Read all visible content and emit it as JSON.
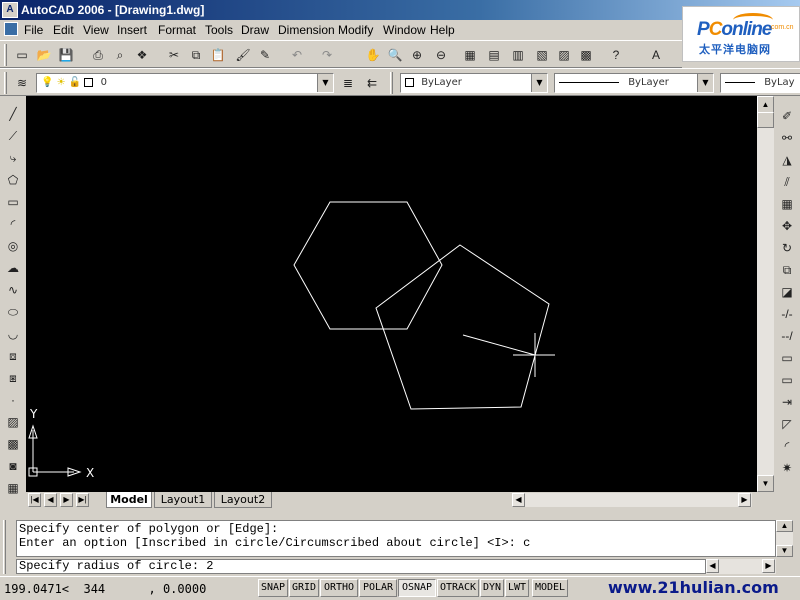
{
  "window": {
    "title": "AutoCAD 2006 - [Drawing1.dwg]",
    "logo": {
      "brand_p": "P",
      "brand_mid": "C",
      "brand_rest": "online",
      "domain": ".com.cn",
      "tagline": "太平洋电脑网"
    }
  },
  "menu": [
    "File",
    "Edit",
    "View",
    "Insert",
    "Format",
    "Tools",
    "Draw",
    "Dimension",
    "Modify",
    "Window",
    "Help"
  ],
  "layers": {
    "current_layer": "0",
    "color": "ByLayer",
    "linetype": "ByLayer",
    "lineweight": "ByLay"
  },
  "ucs": {
    "y_label": "Y",
    "x_label": "X"
  },
  "tabs": {
    "model": "Model",
    "layout1": "Layout1",
    "layout2": "Layout2"
  },
  "command": {
    "history": [
      "Specify center of polygon or [Edge]:",
      "Enter an option [Inscribed in circle/Circumscribed about circle] <I>: c"
    ],
    "prompt": "Specify radius of circle: 2"
  },
  "status": {
    "coordinates": "199.0471<  344      , 0.0000",
    "toggles": [
      {
        "label": "SNAP",
        "on": false
      },
      {
        "label": "GRID",
        "on": false
      },
      {
        "label": "ORTHO",
        "on": false
      },
      {
        "label": "POLAR",
        "on": false
      },
      {
        "label": "OSNAP",
        "on": true
      },
      {
        "label": "OTRACK",
        "on": false
      },
      {
        "label": "DYN",
        "on": false
      },
      {
        "label": "LWT",
        "on": false
      },
      {
        "label": "MODEL",
        "on": false
      }
    ],
    "watermark": "www.21hulian.com"
  },
  "icons": {
    "standard_toolbar": [
      "new-icon",
      "open-icon",
      "save-icon",
      "plot-icon",
      "plot-preview-icon",
      "publish-icon",
      "cut-icon",
      "copy-icon",
      "paste-icon",
      "match-properties-icon",
      "block-editor-icon",
      "undo-icon",
      "redo-icon",
      "pan-icon",
      "zoom-realtime-icon",
      "zoom-window-icon",
      "zoom-previous-icon",
      "properties-icon",
      "design-center-icon",
      "tool-palettes-icon",
      "sheet-set-icon",
      "markup-icon",
      "quickcalc-icon",
      "help-icon",
      "text-style-icon"
    ],
    "draw_toolbar": [
      "line-icon",
      "construction-line-icon",
      "polyline-icon",
      "polygon-icon",
      "rectangle-icon",
      "arc-icon",
      "circle-icon",
      "revision-cloud-icon",
      "spline-icon",
      "ellipse-icon",
      "ellipse-arc-icon",
      "insert-block-icon",
      "make-block-icon",
      "point-icon",
      "hatch-icon",
      "gradient-icon",
      "region-icon",
      "table-icon"
    ],
    "modify_toolbar": [
      "erase-icon",
      "copy-object-icon",
      "mirror-icon",
      "offset-icon",
      "array-icon",
      "move-icon",
      "rotate-icon",
      "scale-icon",
      "stretch-icon",
      "trim-icon",
      "extend-icon",
      "break-at-point-icon",
      "break-icon",
      "join-icon",
      "chamfer-icon",
      "fillet-icon",
      "explode-icon"
    ]
  },
  "colors": {
    "canvas": "#000000",
    "geometry": "#ffffff",
    "title_start": "#0a246a"
  }
}
